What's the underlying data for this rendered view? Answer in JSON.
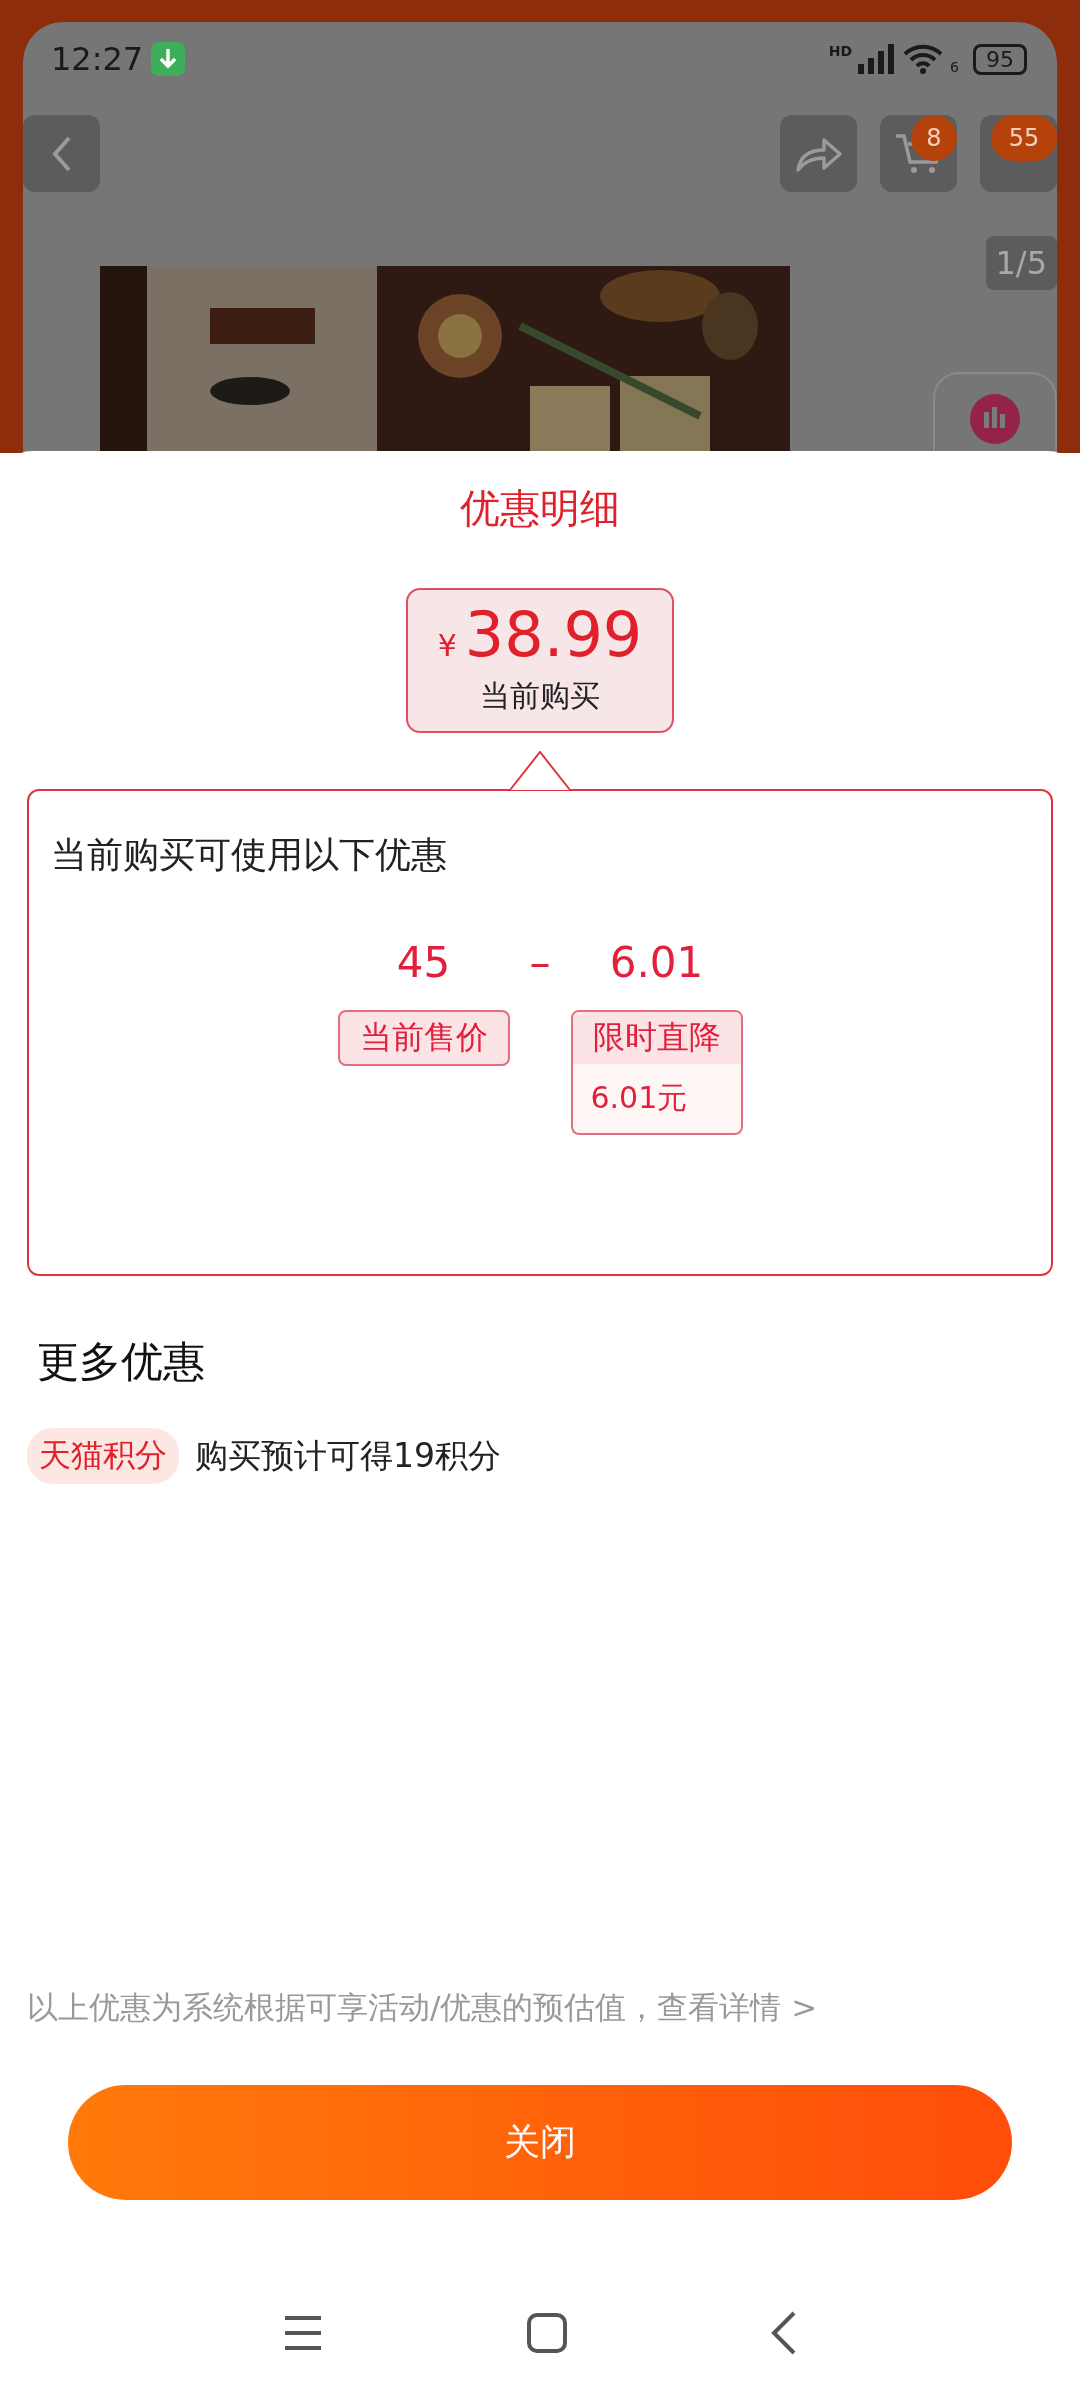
{
  "status_bar": {
    "time": "12:27",
    "signal_label": "HD",
    "wifi_label": "6",
    "battery": "95"
  },
  "product_page": {
    "cart_badge": "8",
    "more_badge": "55",
    "image_counter": "1/5"
  },
  "sheet": {
    "title": "优惠明细",
    "price": {
      "currency": "¥",
      "amount": "38.99",
      "label": "当前购买"
    },
    "breakdown": {
      "heading": "当前购买可使用以下优惠",
      "items": [
        {
          "kind": "value",
          "amount": "45",
          "tag": "当前售价"
        },
        {
          "kind": "operator",
          "symbol": "–"
        },
        {
          "kind": "discount",
          "amount": "6.01",
          "tag": "限时直降",
          "detail": "6.01元"
        }
      ]
    },
    "more_offers": {
      "heading": "更多优惠",
      "items": [
        {
          "tag": "天猫积分",
          "text": "购买预计可得19积分"
        }
      ]
    },
    "footnote": "以上优惠为系统根据可享活动/优惠的预估值，查看详情 >",
    "close_button": "关闭"
  }
}
